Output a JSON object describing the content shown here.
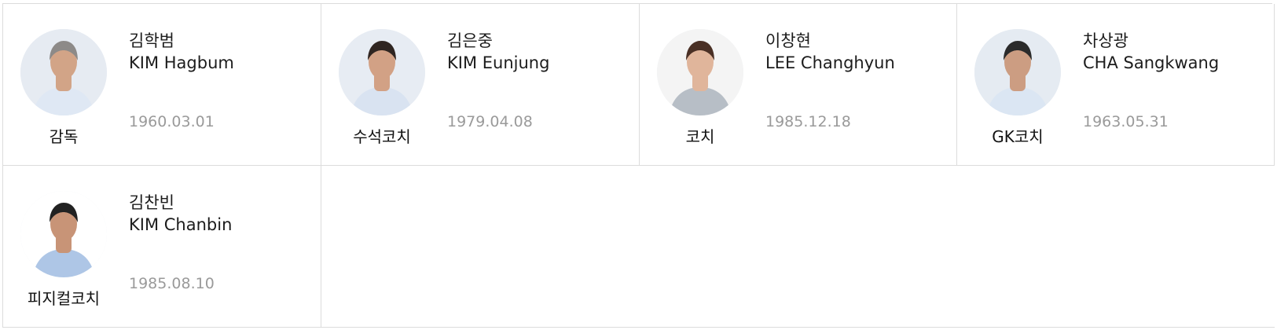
{
  "staff": [
    {
      "name_ko": "김학범",
      "name_en": "KIM Hagbum",
      "birth_date": "1960.03.01",
      "role": "감독",
      "photo_style": {
        "bg": "#e6ebf2",
        "skin": "#d2a487",
        "hair": "#8d8a88",
        "shirt": "#dfe8f4"
      }
    },
    {
      "name_ko": "김은중",
      "name_en": "KIM Eunjung",
      "birth_date": "1979.04.08",
      "role": "수석코치",
      "photo_style": {
        "bg": "#e7ecf3",
        "skin": "#d2a185",
        "hair": "#2f2521",
        "shirt": "#d9e3f1"
      }
    },
    {
      "name_ko": "이창현",
      "name_en": "LEE Changhyun",
      "birth_date": "1985.12.18",
      "role": "코치",
      "photo_style": {
        "bg": "#f4f4f4",
        "skin": "#e0b59b",
        "hair": "#4a3025",
        "shirt": "#b7bec6"
      }
    },
    {
      "name_ko": "차상광",
      "name_en": "CHA Sangkwang",
      "birth_date": "1963.05.31",
      "role": "GK코치",
      "photo_style": {
        "bg": "#e5ebf2",
        "skin": "#cc9d82",
        "hair": "#2b2b2b",
        "shirt": "#dbe6f3"
      }
    },
    {
      "name_ko": "김찬빈",
      "name_en": "KIM Chanbin",
      "birth_date": "1985.08.10",
      "role": "피지컬코치",
      "photo_style": {
        "bg": "#ffffff",
        "skin": "#c89477",
        "hair": "#222222",
        "shirt": "#aec6e6"
      }
    }
  ],
  "layout_meta": {
    "empty_cells": 3
  }
}
